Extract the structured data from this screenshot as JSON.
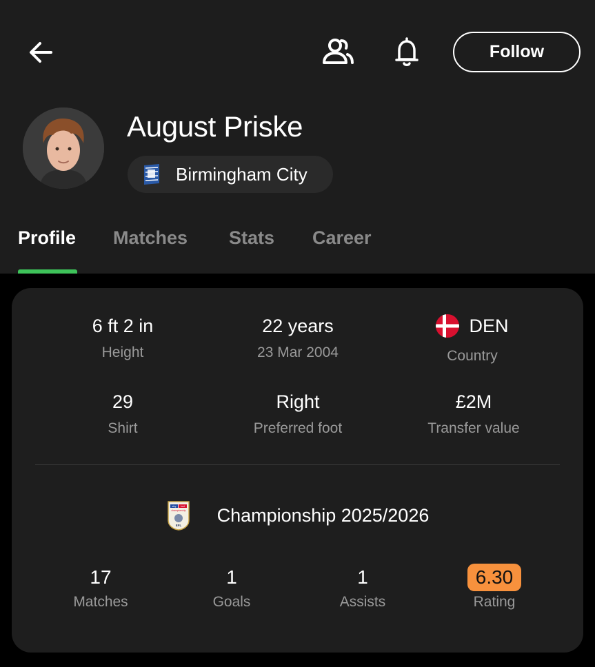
{
  "header": {
    "follow_label": "Follow",
    "player_name": "August Priske",
    "team_name": "Birmingham City"
  },
  "tabs": [
    {
      "label": "Profile",
      "active": true
    },
    {
      "label": "Matches",
      "active": false
    },
    {
      "label": "Stats",
      "active": false
    },
    {
      "label": "Career",
      "active": false
    }
  ],
  "profile": {
    "height": {
      "value": "6 ft 2 in",
      "label": "Height"
    },
    "age": {
      "value": "22 years",
      "label": "23 Mar 2004"
    },
    "country": {
      "value": "DEN",
      "label": "Country"
    },
    "shirt": {
      "value": "29",
      "label": "Shirt"
    },
    "foot": {
      "value": "Right",
      "label": "Preferred foot"
    },
    "transfer": {
      "value": "£2M",
      "label": "Transfer value"
    }
  },
  "season": {
    "league": "Championship 2025/2026",
    "league_logo_text": [
      "sky",
      "bet",
      "championship",
      "EFL"
    ],
    "matches": {
      "value": "17",
      "label": "Matches"
    },
    "goals": {
      "value": "1",
      "label": "Goals"
    },
    "assists": {
      "value": "1",
      "label": "Assists"
    },
    "rating": {
      "value": "6.30",
      "label": "Rating"
    }
  },
  "colors": {
    "accent_green": "#3ec35a",
    "rating_orange": "#f7913d",
    "card_bg": "#1e1e1e",
    "header_bg": "#1d1d1d"
  },
  "icons": [
    "back-arrow-icon",
    "people-icon",
    "bell-icon",
    "denmark-flag-icon",
    "team-crest-icon",
    "league-logo-icon"
  ]
}
